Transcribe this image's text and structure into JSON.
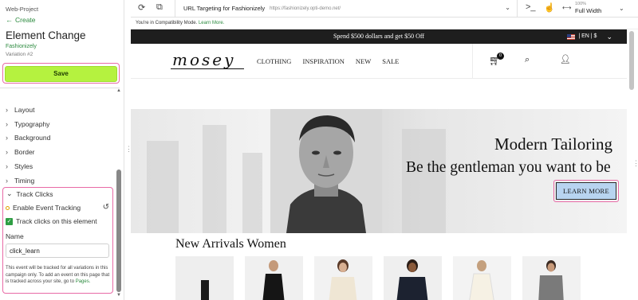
{
  "panel": {
    "project": "Web-Project",
    "back_label": "Create",
    "title": "Element Change",
    "site": "Fashionizely",
    "variation": "Variation #2",
    "save_label": "Save",
    "sections": [
      "Layout",
      "Typography",
      "Background",
      "Border",
      "Styles",
      "Timing"
    ],
    "track": {
      "heading": "Track Clicks",
      "enable_label": "Enable Event Tracking",
      "checkbox_label": "Track clicks on this element",
      "checkbox_checked": true,
      "name_label": "Name",
      "name_value": "click_learn",
      "note": "This event will be tracked for all variations in this campaign only. To add an event on this page that is tracked across your site, go to",
      "note_link": "Pages."
    }
  },
  "toolbar": {
    "url_title": "URL Targeting for Fashionizely",
    "url": "https://fashionizely.opti-demo.net/",
    "zoom_label": "100%",
    "zoom_value": "Full Width"
  },
  "compat": {
    "text": "You're in Compatibility Mode.",
    "link": "Learn More."
  },
  "site": {
    "promo": "Spend $500 dollars and get $50 Off",
    "locale": "| EN | $",
    "logo": "mosey",
    "nav": [
      "CLOTHING",
      "INSPIRATION",
      "NEW",
      "SALE"
    ],
    "cart_count": "0",
    "hero_title": "Modern Tailoring",
    "hero_sub": "Be the gentleman you want to be",
    "cta": "LEARN MORE",
    "section_title": "New Arrivals Women"
  },
  "icons": {
    "refresh": "refresh-icon",
    "screen": "screen-share-icon",
    "terminal": "terminal-icon",
    "pointer": "pointer-icon",
    "resize": "resize-icon"
  },
  "colors": {
    "accent_green": "#2b8a3e",
    "save_green": "#b5f23f",
    "highlight_pink": "#e86aa6",
    "cta_blue": "#b8d4f0",
    "promo_bar": "#1e1e1e"
  }
}
